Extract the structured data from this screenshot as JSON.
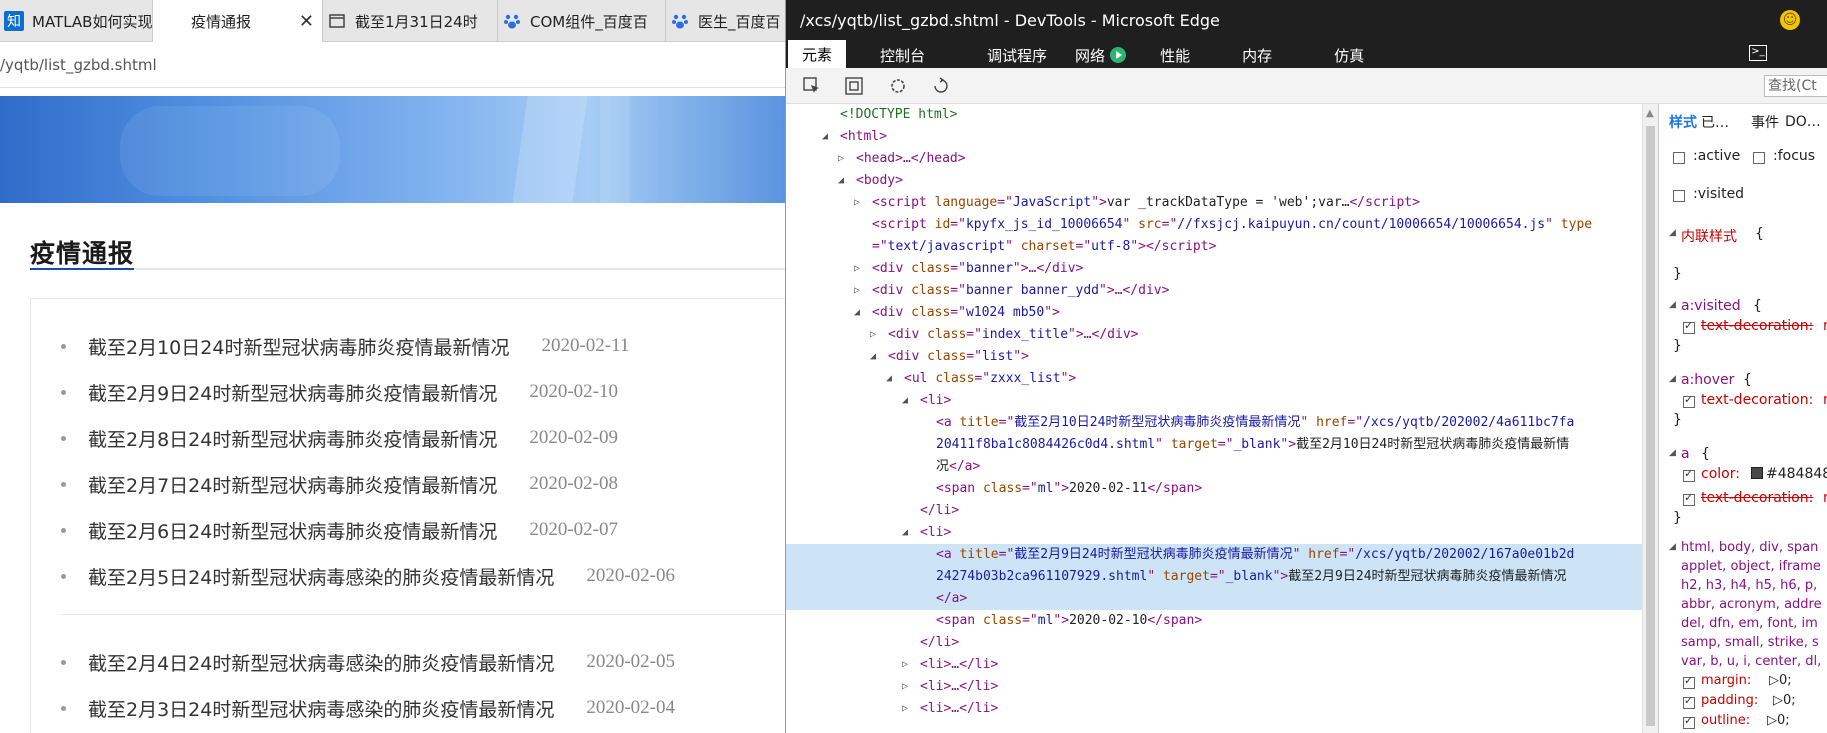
{
  "browser": {
    "tabs": [
      {
        "icon": "知",
        "label": "MATLAB如何实现"
      },
      {
        "icon": "",
        "label": "疫情通报",
        "close": "✕"
      },
      {
        "icon": "",
        "label": "截至1月31日24时"
      },
      {
        "icon": "",
        "label": "COM组件_百度百"
      },
      {
        "icon": "",
        "label": "医生_百度百"
      }
    ],
    "address": "/yqtb/list_gzbd.shtml",
    "page_title": "疫情通报",
    "items": [
      {
        "title": "截至2月10日24时新型冠状病毒肺炎疫情最新情况",
        "date": "2020-02-11"
      },
      {
        "title": "截至2月9日24时新型冠状病毒肺炎疫情最新情况",
        "date": "2020-02-10"
      },
      {
        "title": "截至2月8日24时新型冠状病毒肺炎疫情最新情况",
        "date": "2020-02-09"
      },
      {
        "title": "截至2月7日24时新型冠状病毒肺炎疫情最新情况",
        "date": "2020-02-08"
      },
      {
        "title": "截至2月6日24时新型冠状病毒肺炎疫情最新情况",
        "date": "2020-02-07"
      },
      {
        "title": "截至2月5日24时新型冠状病毒感染的肺炎疫情最新情况",
        "date": "2020-02-06"
      },
      {
        "title": "截至2月4日24时新型冠状病毒感染的肺炎疫情最新情况",
        "date": "2020-02-05"
      },
      {
        "title": "截至2月3日24时新型冠状病毒感染的肺炎疫情最新情况",
        "date": "2020-02-04"
      }
    ]
  },
  "devtools": {
    "window_title": "/xcs/yqtb/list_gzbd.shtml - DevTools - Microsoft Edge",
    "tabs": [
      "元素",
      "控制台",
      "调试程序",
      "网络",
      "性能",
      "内存",
      "仿真"
    ],
    "find_placeholder": "查找(Ct",
    "dom": {
      "doctype": "<!DOCTYPE html>",
      "html_open": "<html>",
      "head": "<head>…</head>",
      "body_open": "<body>",
      "script1_lang": "JavaScript",
      "script1_text": "var _trackDataType = 'web';var…",
      "script2_id": "kpyfx_js_id_10006654",
      "script2_src": "//fxsjcj.kaipuyun.cn/count/10006654/10006654.js",
      "script2_type": "text/javascript",
      "script2_charset": "utf-8",
      "div_banner": "banner",
      "div_banner_ydd": "banner banner_ydd",
      "div_w1024": "w1024 mb50",
      "div_index_title": "index_title",
      "div_list": "list",
      "ul_class": "zxxx_list",
      "a1_title": "截至2月10日24时新型冠状病毒肺炎疫情最新情况",
      "a1_href_1": "/xcs/yqtb/202002/4a611bc7fa",
      "a1_href_2": "20411f8ba1c8084426c0d4.shtml",
      "a1_text_1": "截至2月10日24时新型冠状病毒肺炎疫情最新情",
      "a1_text_2": "况",
      "span1": "2020-02-11",
      "a2_title": "截至2月9日24时新型冠状病毒肺炎疫情最新情况",
      "a2_href_1": "/xcs/yqtb/202002/167a0e01b2d",
      "a2_href_2": "24274b03b2ca961107929.shtml",
      "a2_text": "截至2月9日24时新型冠状病毒肺炎疫情最新情况",
      "span2": "2020-02-10",
      "target": "_blank",
      "span_class": "ml",
      "li_collapsed": "<li>…</li>"
    },
    "styles": {
      "tab_styles": "样式",
      "tab_computed": "已…",
      "tab_events": "事件",
      "tab_dom": "DO…",
      "pseudo_active": ":active",
      "pseudo_focus": ":focus",
      "pseudo_visited": ":visited",
      "inline_label": "内联样式",
      "brace_open": "{",
      "brace_close": "}",
      "rule_visited": "a:visited",
      "rule_hover": "a:hover",
      "rule_a": "a",
      "prop_text_decoration": "text-decoration:",
      "prop_text_decoration_val": "n",
      "prop_color": "color:",
      "color_value": "#484848",
      "color_hex": "#484848",
      "reset_selector_1": "html, body, div, span",
      "reset_selector_2": "applet, object, iframe",
      "reset_selector_3": "h2, h3, h4, h5, h6, p,",
      "reset_selector_4": "abbr, acronym, addre",
      "reset_selector_5": "del, dfn, em, font, im",
      "reset_selector_6": "samp, small, strike, s",
      "reset_selector_7": "var, b, u, i, center, dl,",
      "prop_margin": "margin:",
      "prop_padding": "padding:",
      "prop_outline": "outline:",
      "zero_val": "▷0;"
    }
  }
}
